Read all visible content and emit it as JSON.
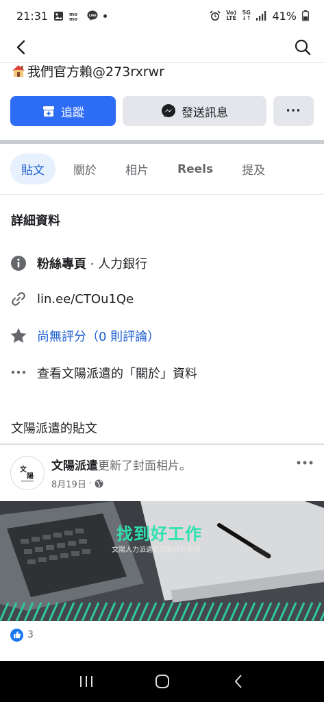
{
  "status_bar": {
    "time": "21:31",
    "battery": "41%",
    "network_labels": [
      "Vo)",
      "LTE",
      "5G"
    ],
    "notif_icons": [
      "gallery-icon",
      "momo-icon",
      "line-icon",
      "dot-icon"
    ],
    "system_icons": [
      "alarm-icon",
      "volte-icon",
      "5g-icon",
      "signal-icon",
      "battery-icon"
    ]
  },
  "nav": {
    "back_icon": "back-chevron-icon",
    "search_icon": "search-icon"
  },
  "page": {
    "headline_text": "我們官方賴@273rxrwr"
  },
  "actions": {
    "follow_label": "追蹤",
    "message_label": "發送訊息",
    "more_label": "···"
  },
  "tabs": [
    {
      "label": "貼文",
      "active": true
    },
    {
      "label": "關於",
      "active": false
    },
    {
      "label": "相片",
      "active": false
    },
    {
      "label": "Reels",
      "active": false
    },
    {
      "label": "提及",
      "active": false
    }
  ],
  "details": {
    "title": "詳細資料",
    "category_bold": "粉絲專頁",
    "category_rest": " · 人力銀行",
    "link": "lin.ee/CTOu1Qe",
    "rating": "尚無評分（0 則評論）",
    "about": "查看文陽派遣的「關於」資料"
  },
  "posts": {
    "title": "文陽派遣的貼文",
    "author": "文陽派遣",
    "action": "更新了封面相片。",
    "date": "8月19日",
    "separator": "·",
    "avatar_text_top": "文",
    "avatar_text_bottom": "陽",
    "cover_title": "找到好工作",
    "cover_subtitle": "文陽人力派遣是您最好的選擇",
    "reaction_count": "3"
  },
  "colors": {
    "brand_blue": "#2d6cf5",
    "link_blue": "#1b5dcf",
    "tab_active_bg": "#e7f0fd",
    "cover_accent": "#2fe0b0"
  }
}
